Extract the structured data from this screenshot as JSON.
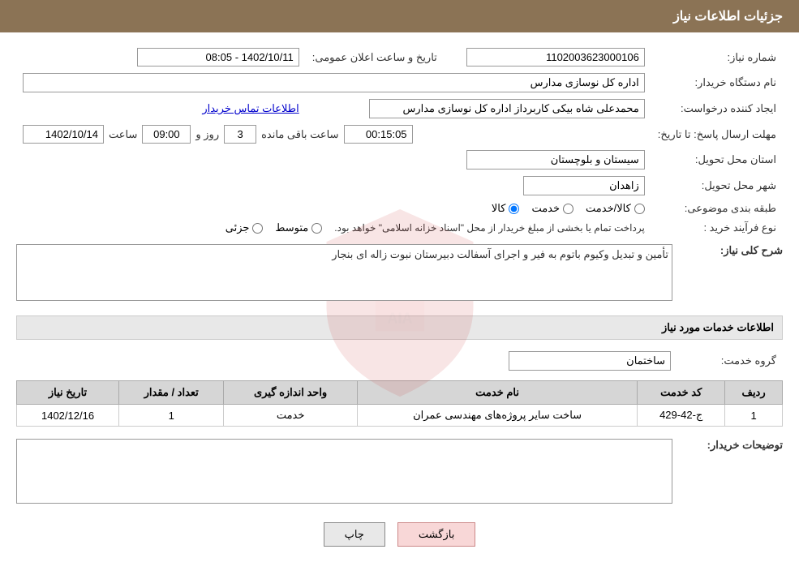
{
  "header": {
    "title": "جزئیات اطلاعات نیاز"
  },
  "fields": {
    "request_number_label": "شماره نیاز:",
    "request_number_value": "1102003623000106",
    "buyer_org_label": "نام دستگاه خریدار:",
    "buyer_org_value": "اداره کل نوسازی مدارس",
    "creator_label": "ایجاد کننده درخواست:",
    "creator_value": "محمدعلی شاه بیکی کاربرداز اداره کل نوسازی مدارس",
    "creator_link": "اطلاعات تماس خریدار",
    "announcement_date_label": "تاریخ و ساعت اعلان عمومی:",
    "announcement_date_value": "1402/10/11 - 08:05",
    "deadline_label": "مهلت ارسال پاسخ: تا تاریخ:",
    "deadline_date": "1402/10/14",
    "deadline_time_label": "ساعت",
    "deadline_time": "09:00",
    "deadline_days_label": "روز و",
    "deadline_days": "3",
    "deadline_remaining_label": "ساعت باقی مانده",
    "deadline_remaining": "00:15:05",
    "province_label": "استان محل تحویل:",
    "province_value": "سیستان و بلوچستان",
    "city_label": "شهر محل تحویل:",
    "city_value": "زاهدان",
    "category_label": "طبقه بندی موضوعی:",
    "category_options": [
      {
        "label": "کالا",
        "selected": true
      },
      {
        "label": "خدمت",
        "selected": false
      },
      {
        "label": "کالا/خدمت",
        "selected": false
      }
    ],
    "purchase_type_label": "نوع فرآیند خرید :",
    "purchase_type_options": [
      {
        "label": "جزئی",
        "selected": false
      },
      {
        "label": "متوسط",
        "selected": false
      }
    ],
    "purchase_type_note": "پرداخت تمام یا بخشی از مبلغ خریدار از محل \"اسناد خزانه اسلامی\" خواهد بود.",
    "general_desc_label": "شرح کلی نیاز:",
    "general_desc_value": "تأمین و تبدیل وکیوم باتوم به فیر و اجرای آسفالت دبیرستان نبوت زاله ای بنجار",
    "services_section_label": "اطلاعات خدمات مورد نیاز",
    "service_group_label": "گروه خدمت:",
    "service_group_value": "ساختمان",
    "table": {
      "headers": [
        "ردیف",
        "کد خدمت",
        "نام خدمت",
        "واحد اندازه گیری",
        "تعداد / مقدار",
        "تاریخ نیاز"
      ],
      "rows": [
        {
          "row": "1",
          "code": "ج-42-429",
          "name": "ساخت سایر پروژه‌های مهندسی عمران",
          "unit": "خدمت",
          "count": "1",
          "date": "1402/12/16"
        }
      ]
    },
    "buyer_desc_label": "توضیحات خریدار:",
    "buyer_desc_value": ""
  },
  "buttons": {
    "print": "چاپ",
    "back": "بازگشت"
  }
}
